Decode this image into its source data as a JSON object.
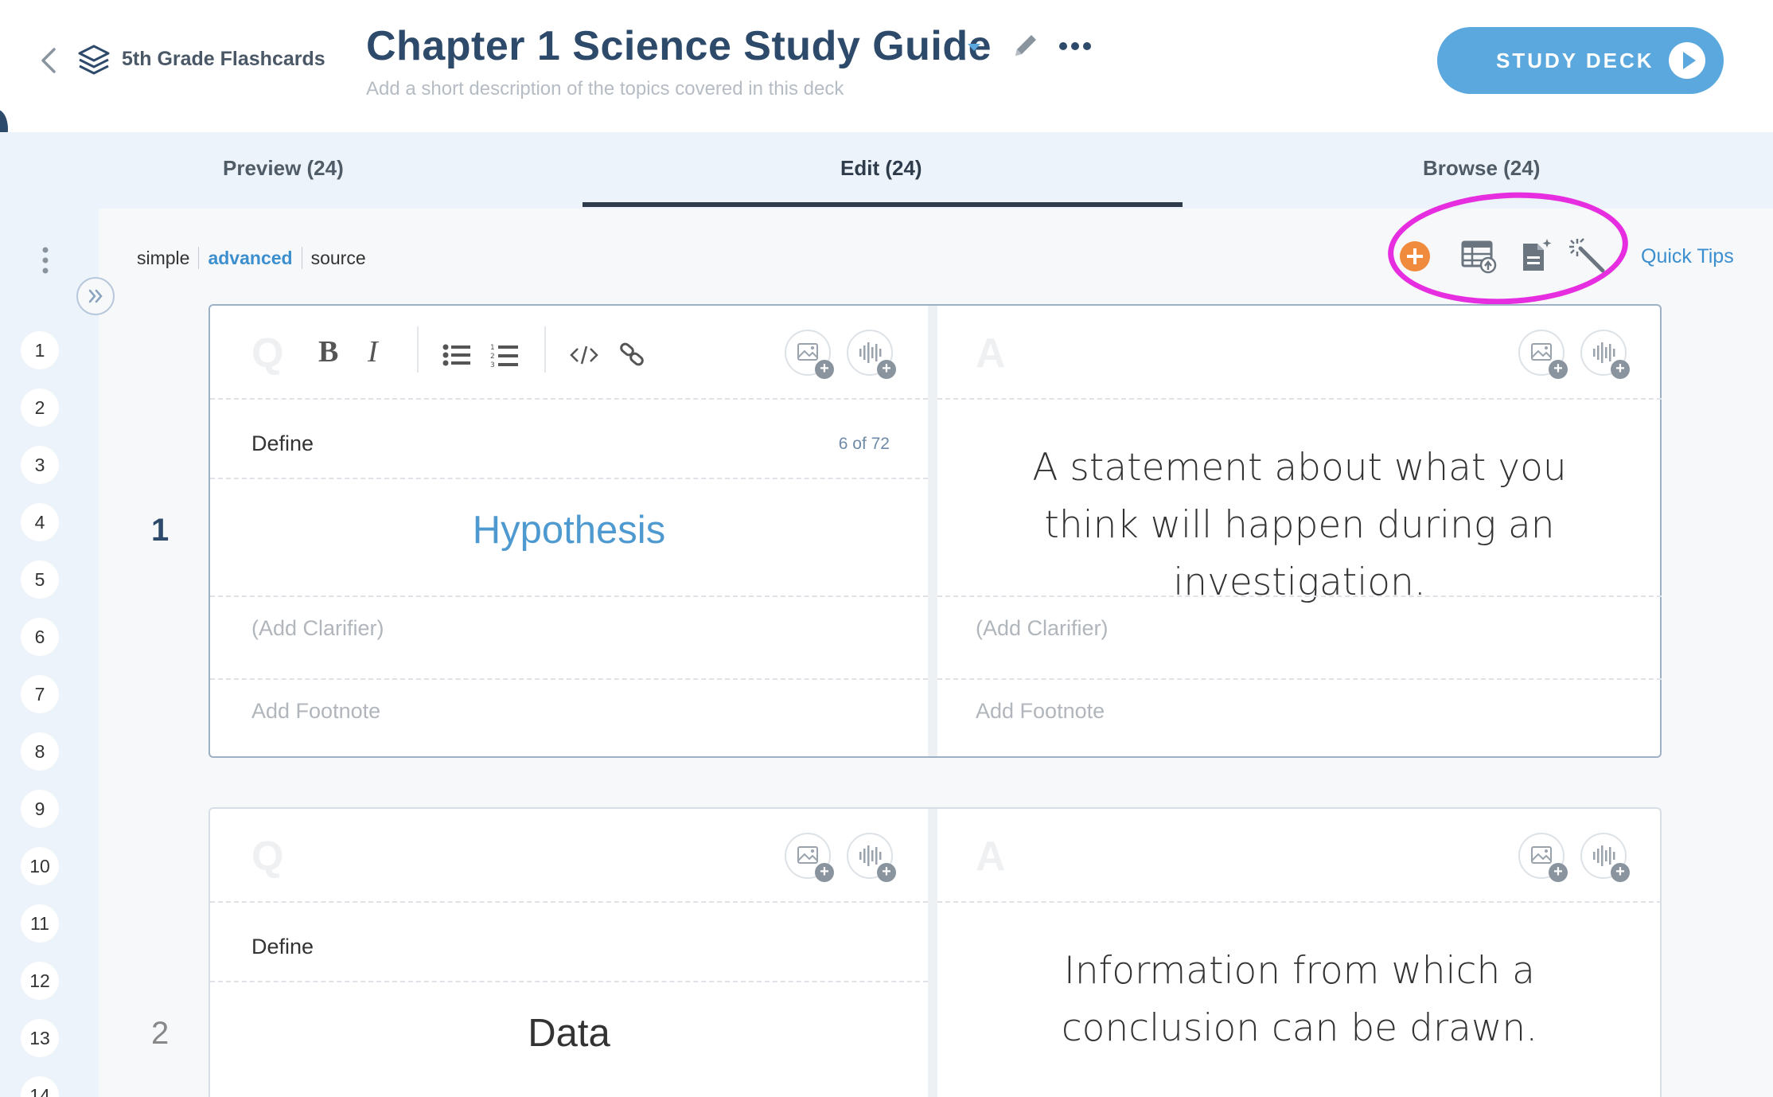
{
  "header": {
    "breadcrumb": "5th Grade Flashcards",
    "title": "Chapter 1 Science Study Guide",
    "description_placeholder": "Add a short description of the topics covered in this deck",
    "study_button": "STUDY DECK"
  },
  "tabs": [
    {
      "label": "Preview (24)",
      "active": false
    },
    {
      "label": "Edit (24)",
      "active": true
    },
    {
      "label": "Browse (24)",
      "active": false
    }
  ],
  "editor_modes": {
    "simple": "simple",
    "advanced": "advanced",
    "source": "source",
    "active": "advanced"
  },
  "quick_tips": "Quick Tips",
  "highlight_color": "#e62ee0",
  "accent_color": "#5aa8dd",
  "card_numbers": [
    "1",
    "2",
    "3",
    "4",
    "5",
    "6",
    "7",
    "8",
    "9",
    "10",
    "11",
    "12",
    "13",
    "14"
  ],
  "cards": [
    {
      "number": "1",
      "q_letter": "Q",
      "a_letter": "A",
      "prompt": "Define",
      "count": "6 of 72",
      "term": "Hypothesis",
      "answer": "A statement about what you think will happen during an investigation.",
      "clarifier_placeholder": "(Add Clarifier)",
      "footnote_placeholder": "Add Footnote"
    },
    {
      "number": "2",
      "q_letter": "Q",
      "a_letter": "A",
      "prompt": "Define",
      "term": "Data",
      "answer": "Information from which a conclusion can be drawn."
    }
  ]
}
